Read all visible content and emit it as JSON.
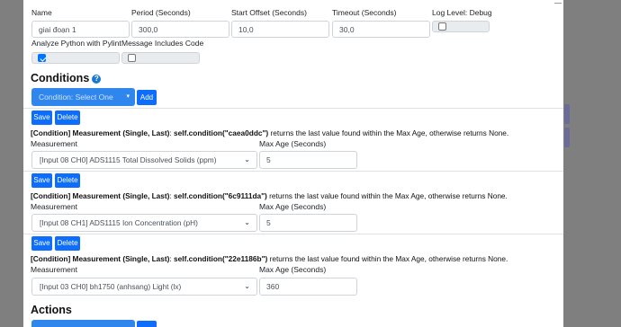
{
  "top_fields": {
    "name_label": "Name",
    "name_value": "giai đoạn 1",
    "period_label": "Period (Seconds)",
    "period_value": "300,0",
    "start_offset_label": "Start Offset (Seconds)",
    "start_offset_value": "10,0",
    "timeout_label": "Timeout (Seconds)",
    "timeout_value": "30,0",
    "log_level_label": "Log Level: Debug",
    "log_level_checked": false,
    "pylint_label": "Analyze Python with Pylint",
    "pylint_checked": true,
    "message_code_label": "Message Includes Code",
    "message_code_checked": false
  },
  "conditions": {
    "title": "Conditions",
    "help_icon": "question-circle-icon",
    "select_placeholder": "Condition: Select One",
    "add_label": "Add",
    "items": [
      {
        "save_label": "Save",
        "delete_label": "Delete",
        "desc_bold": "[Condition] Measurement (Single, Last)",
        "desc_sep": ": ",
        "desc_code": "self.condition(\"caea0ddc\")",
        "desc_rest": " returns the last value found within the Max Age, otherwise returns None.",
        "measurement_label": "Measurement",
        "measurement_value": "[Input 08 CH0] ADS1115 Total Dissolved Solids (ppm)",
        "max_age_label": "Max Age (Seconds)",
        "max_age_value": "5"
      },
      {
        "save_label": "Save",
        "delete_label": "Delete",
        "desc_bold": "[Condition] Measurement (Single, Last)",
        "desc_sep": ": ",
        "desc_code": "self.condition(\"6c9111da\")",
        "desc_rest": " returns the last value found within the Max Age, otherwise returns None.",
        "measurement_label": "Measurement",
        "measurement_value": "[Input 08 CH1] ADS1115 Ion Concentration (pH)",
        "max_age_label": "Max Age (Seconds)",
        "max_age_value": "5"
      },
      {
        "save_label": "Save",
        "delete_label": "Delete",
        "desc_bold": "[Condition] Measurement (Single, Last)",
        "desc_sep": ": ",
        "desc_code": "self.condition(\"22e1186b\")",
        "desc_rest": " returns the last value found within the Max Age, otherwise returns None.",
        "measurement_label": "Measurement",
        "measurement_value": "[Input 03 CH0] bh1750 (anhsang) Light (lx)",
        "max_age_label": "Max Age (Seconds)",
        "max_age_value": "360"
      }
    ]
  },
  "actions": {
    "title": "Actions"
  },
  "colors": {
    "primary": "#0d6efd",
    "backdrop": "#7a7a7a",
    "help": "#1b78d1"
  }
}
